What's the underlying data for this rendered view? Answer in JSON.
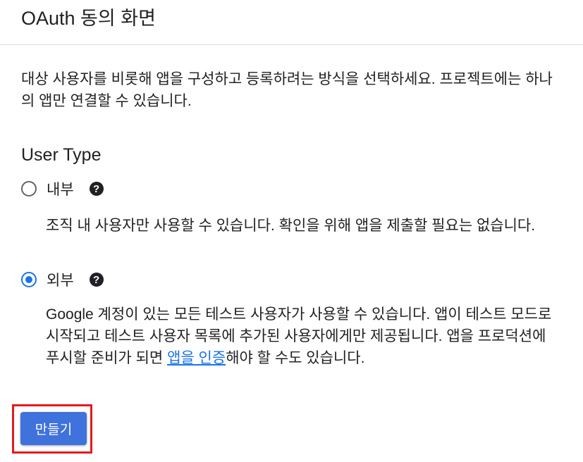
{
  "header": {
    "title": "OAuth 동의 화면"
  },
  "description": "대상 사용자를 비롯해 앱을 구성하고 등록하려는 방식을 선택하세요. 프로젝트에는 하나의 앱만 연결할 수 있습니다.",
  "user_type": {
    "label": "User Type",
    "options": [
      {
        "label": "내부",
        "selected": false,
        "help_icon": "help-icon",
        "description": "조직 내 사용자만 사용할 수 있습니다. 확인을 위해 앱을 제출할 필요는 없습니다."
      },
      {
        "label": "외부",
        "selected": true,
        "help_icon": "help-icon",
        "description_before": "Google 계정이 있는 모든 테스트 사용자가 사용할 수 있습니다. 앱이 테스트 모드로 시작되고 테스트 사용자 목록에 추가된 사용자에게만 제공됩니다. 앱을 프로덕션에 푸시할 준비가 되면 ",
        "link_text": "앱을 인증",
        "description_after": "해야 할 수도 있습니다."
      }
    ]
  },
  "actions": {
    "create_label": "만들기"
  },
  "colors": {
    "accent": "#1a73e8",
    "button": "#3f72dc",
    "highlight": "#e21b1b"
  }
}
